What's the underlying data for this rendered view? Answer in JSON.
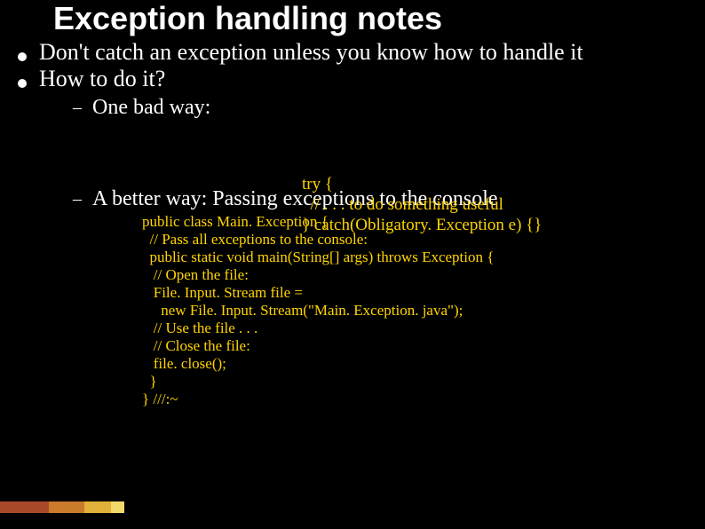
{
  "title": "Exception handling notes",
  "bullets": {
    "b1": "Don't catch an exception unless you know how to handle it",
    "b2": "How to do it?"
  },
  "sub": {
    "oneBad": "One bad way:",
    "better": "A better way: Passing exceptions to the console"
  },
  "code": {
    "bad": "try {\n  // . . . to do something useful\n} catch(Obligatory. Exception e) {}",
    "good": "public class Main. Exception {\n  // Pass all exceptions to the console:\n  public static void main(String[] args) throws Exception {\n   // Open the file:\n   File. Input. Stream file =\n     new File. Input. Stream(\"Main. Exception. java\");\n   // Use the file . . .\n   // Close the file:\n   file. close();\n  }\n} ///:~"
  }
}
